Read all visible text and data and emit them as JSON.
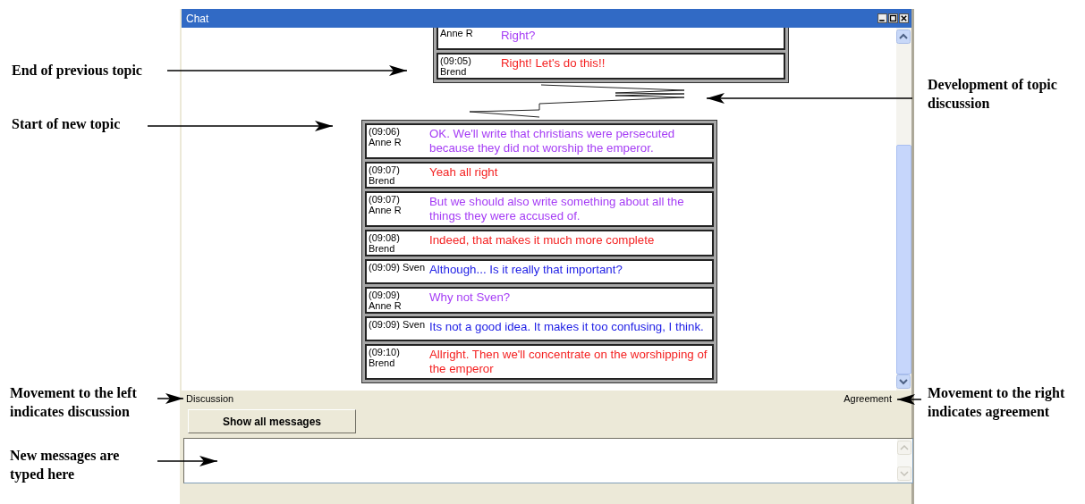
{
  "window": {
    "title": "Chat"
  },
  "groups": [
    {
      "messages": [
        {
          "author": "Anne R",
          "text": "Right?",
          "color": "#a53cf5"
        },
        {
          "time": "(09:05)",
          "author": "Brend",
          "text": "Right! Let's do this!!",
          "color": "#f42222"
        }
      ]
    },
    {
      "messages": [
        {
          "time": "(09:06)",
          "author": "Anne R",
          "text": "OK. We'll write that christians were persecuted because they did not worship the emperor.",
          "color": "#a53cf5"
        },
        {
          "time": "(09:07)",
          "author": "Brend",
          "text": "Yeah all right",
          "color": "#f42222"
        },
        {
          "time": "(09:07)",
          "author": "Anne R",
          "text": "But we should also write something about all the things they were accused of.",
          "color": "#a53cf5"
        },
        {
          "time": "(09:08)",
          "author": "Brend",
          "text": "Indeed, that makes it much more complete",
          "color": "#f42222"
        },
        {
          "time": "(09:09)",
          "author": "Sven",
          "text": "Although... Is it really that important?",
          "color": "#2222e6"
        },
        {
          "time": "(09:09)",
          "author": "Anne R",
          "text": "Why not Sven?",
          "color": "#a53cf5"
        },
        {
          "time": "(09:09)",
          "author": "Sven",
          "text": "Its not a good idea. It makes it too confusing, I think.",
          "color": "#2222e6"
        },
        {
          "time": "(09:10)",
          "author": "Brend",
          "text": "Allright. Then we'll concentrate on the worshipping of the emperor",
          "color": "#f42222"
        }
      ]
    }
  ],
  "scale": {
    "left_label": "Discussion",
    "right_label": "Agreement"
  },
  "show_all_button": "Show all messages",
  "annotations": [
    "End of previous topic",
    "Development of topic discussion",
    "Start of new topic",
    "Movement to the left indicates discussion",
    "Movement to the right indicates agreement",
    "New messages are typed here"
  ]
}
